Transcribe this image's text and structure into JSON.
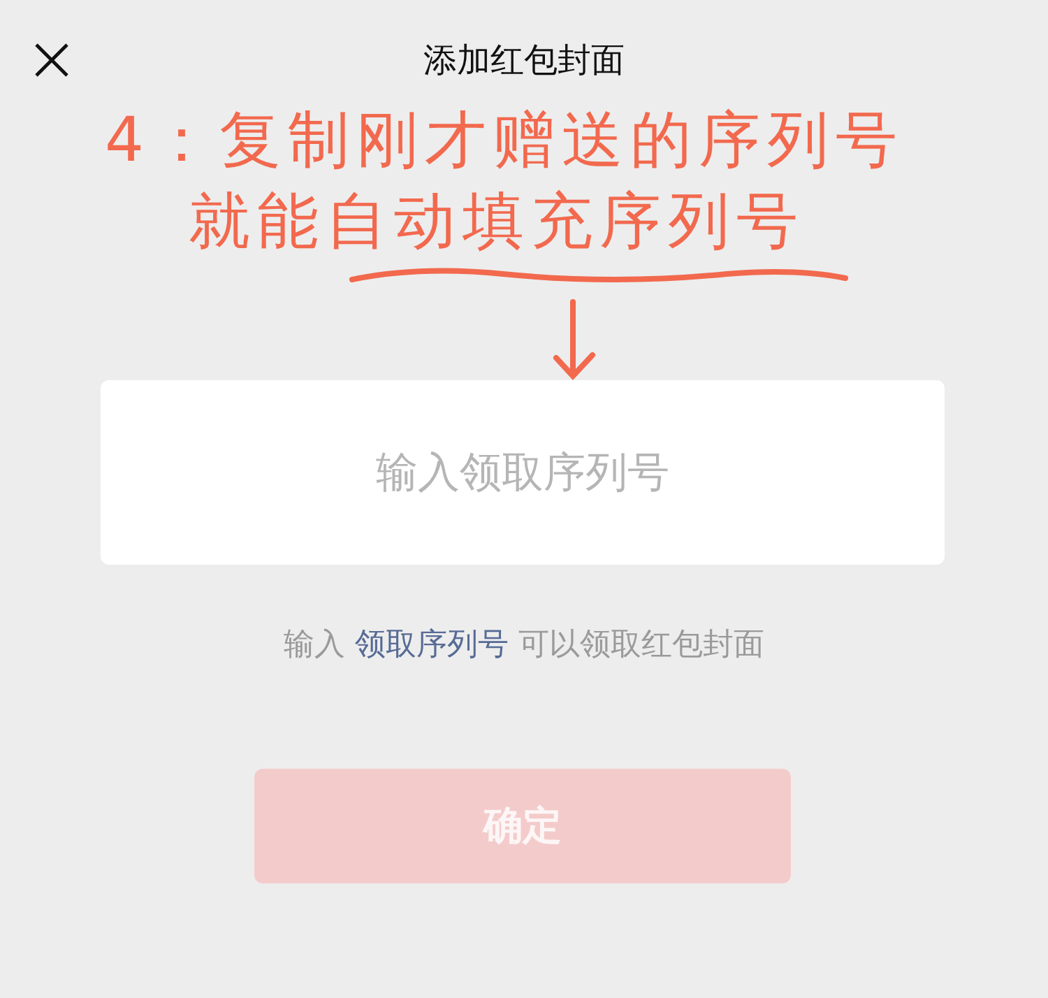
{
  "header": {
    "title": "添加红包封面"
  },
  "annotation": {
    "lines": [
      "4：复制刚才赠送的序列号",
      "就能自动填充序列号"
    ]
  },
  "serial_field": {
    "placeholder": "输入领取序列号"
  },
  "hint": {
    "before": "输入",
    "link": "领取序列号",
    "after": "可以领取红包封面"
  },
  "confirm_button": {
    "label": "确定",
    "disabled": true
  }
}
